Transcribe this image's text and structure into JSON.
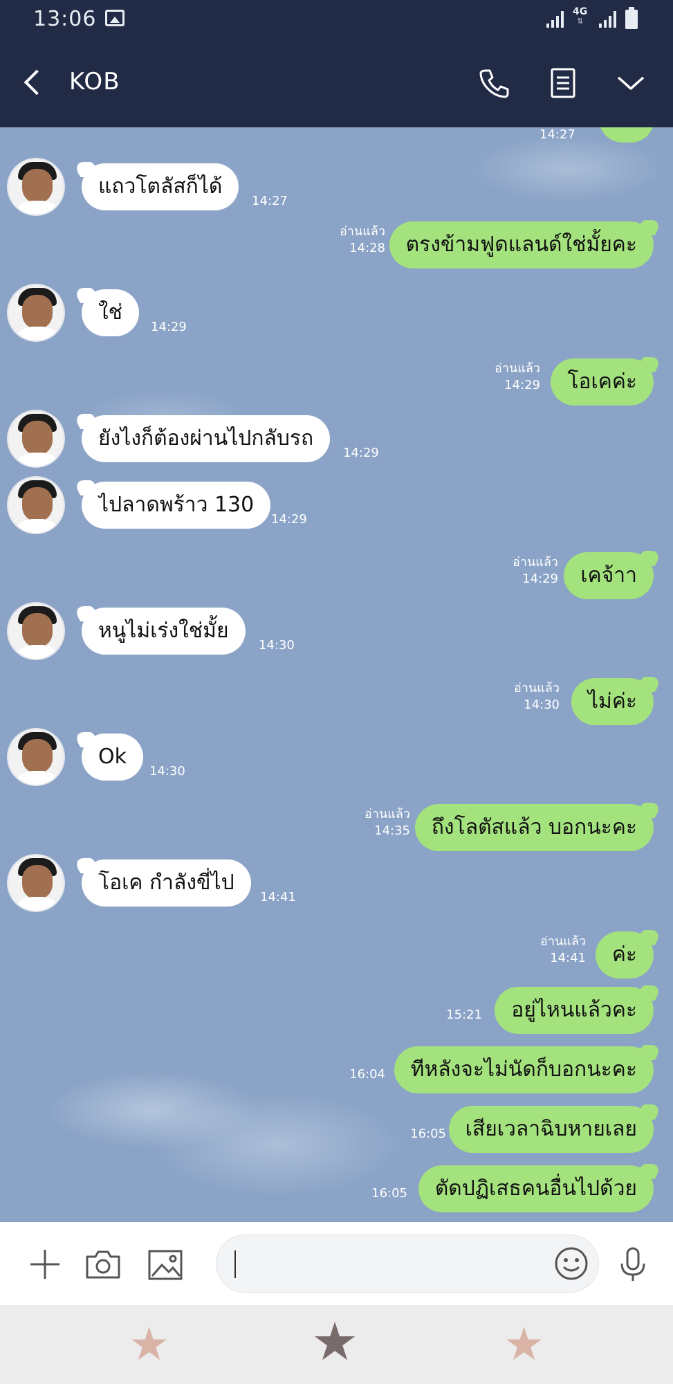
{
  "status_bar": {
    "time": "13:06",
    "network": "4G"
  },
  "header": {
    "title": "KOB",
    "icons": [
      "back-icon",
      "phone-icon",
      "notes-icon",
      "chevron-down-icon"
    ]
  },
  "chat": {
    "top_partial": {
      "time": "14:27"
    },
    "messages": [
      {
        "id": "m1",
        "side": "in",
        "text": "แถวโตลัสก็ได้",
        "time": "14:27"
      },
      {
        "id": "m2",
        "side": "out",
        "text": "ตรงข้ามฟูดแลนด์ใช่มั้ยคะ",
        "read": "อ่านแล้ว",
        "time": "14:28"
      },
      {
        "id": "m3",
        "side": "in",
        "text": "ใช่",
        "time": "14:29"
      },
      {
        "id": "m4",
        "side": "out",
        "text": "โอเคค่ะ",
        "read": "อ่านแล้ว",
        "time": "14:29"
      },
      {
        "id": "m5",
        "side": "in",
        "text": "ยังไงก็ต้องผ่านไปกลับรถ",
        "time": "14:29"
      },
      {
        "id": "m6",
        "side": "in",
        "text": "ไปลาดพร้าว 130",
        "time": "14:29"
      },
      {
        "id": "m7",
        "side": "out",
        "text": "เคจ้าา",
        "read": "อ่านแล้ว",
        "time": "14:29"
      },
      {
        "id": "m8",
        "side": "in",
        "text": "หนูไม่เร่งใช่มั้ย",
        "time": "14:30"
      },
      {
        "id": "m9",
        "side": "out",
        "text": "ไม่ค่ะ",
        "read": "อ่านแล้ว",
        "time": "14:30"
      },
      {
        "id": "m10",
        "side": "in",
        "text": "Ok",
        "time": "14:30"
      },
      {
        "id": "m11",
        "side": "out",
        "text": "ถึงโลตัสแล้ว บอกนะคะ",
        "read": "อ่านแล้ว",
        "time": "14:35"
      },
      {
        "id": "m12",
        "side": "in",
        "text": "โอเค กำลังขี่ไป",
        "time": "14:41"
      },
      {
        "id": "m13",
        "side": "out",
        "text": "ค่ะ",
        "read": "อ่านแล้ว",
        "time": "14:41"
      },
      {
        "id": "m14",
        "side": "out",
        "text": "อยู่ไหนแล้วคะ",
        "time": "15:21"
      },
      {
        "id": "m15",
        "side": "out",
        "text": "ทีหลังจะไม่นัดก็บอกนะคะ",
        "time": "16:04"
      },
      {
        "id": "m16",
        "side": "out",
        "text": "เสียเวลาฉิบหายเลย",
        "time": "16:05"
      },
      {
        "id": "m17",
        "side": "out",
        "text": "ตัดปฏิเสธคนอื่นไปด้วย",
        "time": "16:05"
      }
    ]
  },
  "input_bar": {
    "message_value": "",
    "icons": [
      "plus-icon",
      "camera-icon",
      "image-icon",
      "emoji-icon",
      "microphone-icon"
    ]
  },
  "sticker_bar": {
    "stars": [
      "★",
      "★",
      "★"
    ]
  },
  "colors": {
    "header_bg": "#212b45",
    "chat_bg": "#8aa3c6",
    "outgoing_bubble": "#a4e27e",
    "incoming_bubble": "#ffffff"
  }
}
